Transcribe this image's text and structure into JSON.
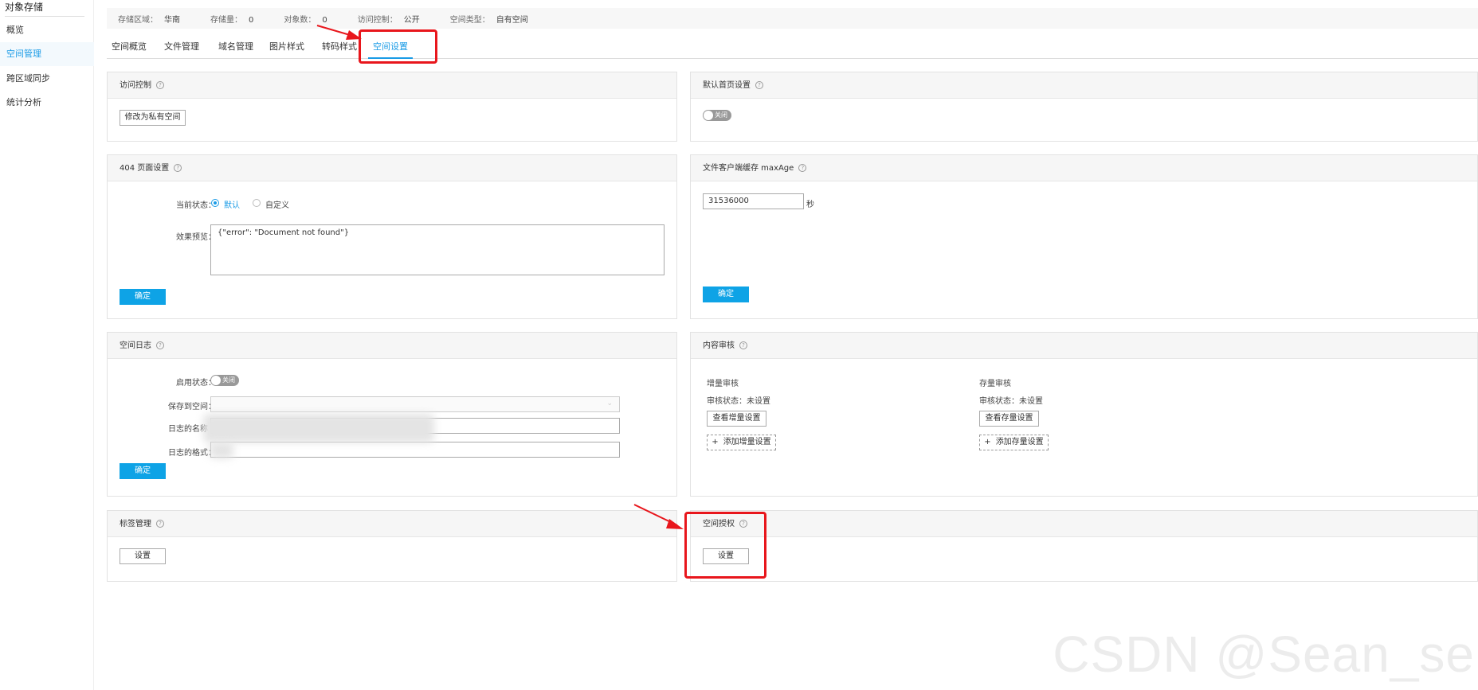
{
  "sidebar": {
    "title": "对象存储",
    "items": [
      {
        "label": "概览"
      },
      {
        "label": "空间管理"
      },
      {
        "label": "跨区域同步"
      },
      {
        "label": "统计分析"
      }
    ]
  },
  "infobar": [
    {
      "label": "存储区域：",
      "value": "华南"
    },
    {
      "label": "存储量：",
      "value": "0"
    },
    {
      "label": "对象数：",
      "value": "0"
    },
    {
      "label": "访问控制：",
      "value": "公开"
    },
    {
      "label": "空间类型：",
      "value": "自有空间"
    }
  ],
  "tabs": [
    {
      "label": "空间概览"
    },
    {
      "label": "文件管理"
    },
    {
      "label": "域名管理"
    },
    {
      "label": "图片样式"
    },
    {
      "label": "转码样式"
    },
    {
      "label": "空间设置"
    }
  ],
  "access": {
    "title": "访问控制",
    "button": "修改为私有空间"
  },
  "homepage": {
    "title": "默认首页设置",
    "toggle": "关闭"
  },
  "page404": {
    "title": "404 页面设置",
    "status_label": "当前状态：",
    "opt_default": "默认",
    "opt_custom": "自定义",
    "preview_label": "效果预览：",
    "preview_text": "{\"error\": \"Document not found\"}",
    "confirm": "确定"
  },
  "maxage": {
    "title": "文件客户端缓存 maxAge",
    "value": "31536000",
    "unit": "秒",
    "confirm": "确定"
  },
  "logs": {
    "title": "空间日志",
    "enable_label": "启用状态：",
    "toggle": "关闭",
    "save_label": "保存到空间：",
    "name_label": "日志的名称",
    "format_label": "日志的格式：",
    "confirm": "确定"
  },
  "audit": {
    "title": "内容审核",
    "incremental": {
      "title": "增量审核",
      "status": "审核状态：未设置",
      "view": "查看增量设置",
      "add": "添加增量设置"
    },
    "stock": {
      "title": "存量审核",
      "status": "审核状态：未设置",
      "view": "查看存量设置",
      "add": "添加存量设置"
    }
  },
  "tags": {
    "title": "标签管理",
    "button": "设置"
  },
  "auth": {
    "title": "空间授权",
    "button": "设置"
  },
  "watermark": "CSDN @Sean_se",
  "colors": {
    "accent": "#1a9be6",
    "primary_button": "#0ea3e6",
    "highlight": "#e8161c"
  }
}
